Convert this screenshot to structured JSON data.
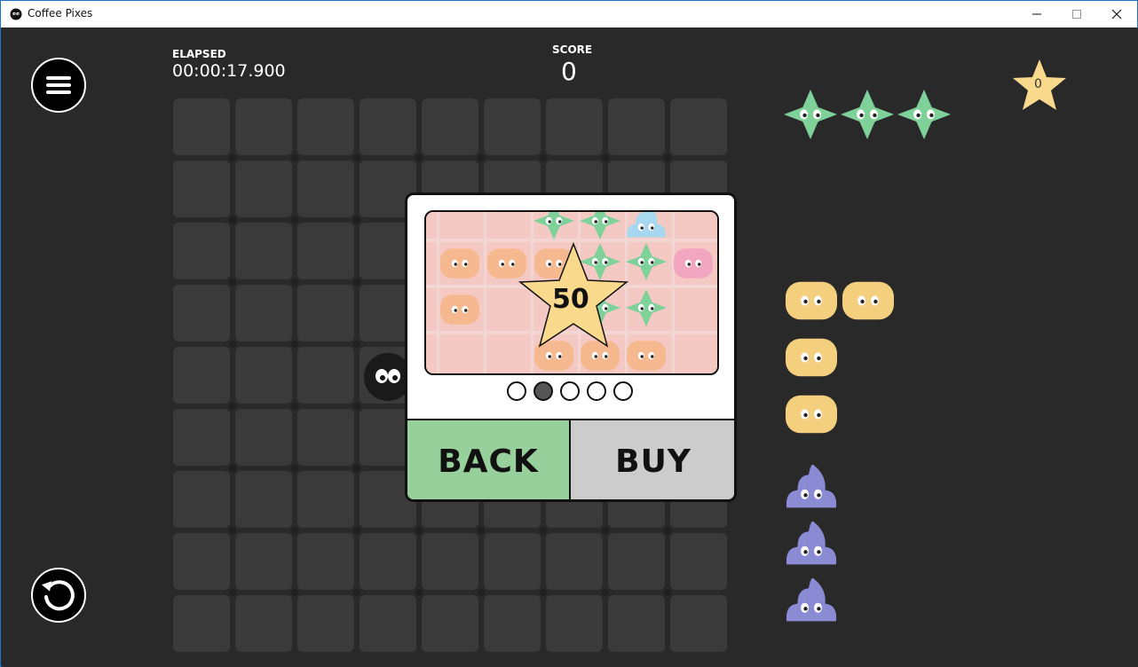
{
  "window": {
    "title": "Coffee Pixes",
    "controls": [
      "minimize",
      "maximize",
      "close"
    ]
  },
  "hud": {
    "elapsed_label": "ELAPSED",
    "elapsed_value": "00:00:17.900",
    "score_label": "SCORE",
    "score_value": "0",
    "stars_value": "0"
  },
  "icons": {
    "menu": "hamburger-menu-icon",
    "restart": "restart-arrow-icon",
    "star": "star-icon"
  },
  "modal": {
    "price": "50",
    "back_label": "BACK",
    "buy_label": "BUY",
    "page_count": 5,
    "current_page": 2
  },
  "colors": {
    "background": "#292929",
    "cell": "#3a3a3a",
    "star": "#f9d98b",
    "green_pixe": "#7fd19a",
    "orange_pixe": "#f6b88e",
    "yellow_pixe": "#f4cf7e",
    "purple_pixe": "#8a8bd4",
    "pink_pixe": "#f3a6bf",
    "blue_pixe": "#a8d8f0",
    "back_button": "#97d09b",
    "buy_button": "#cccccc"
  },
  "queue": {
    "green": 3,
    "yellow": 4,
    "purple": 3
  }
}
